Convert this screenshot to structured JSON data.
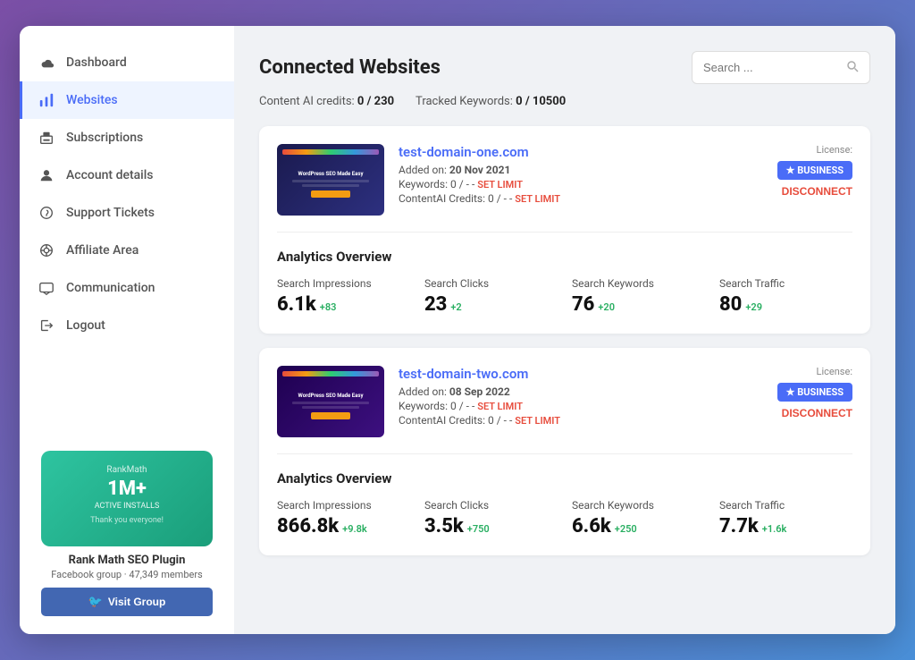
{
  "sidebar": {
    "items": [
      {
        "id": "dashboard",
        "label": "Dashboard",
        "icon": "cloud-icon",
        "active": false
      },
      {
        "id": "websites",
        "label": "Websites",
        "icon": "chart-icon",
        "active": true
      },
      {
        "id": "subscriptions",
        "label": "Subscriptions",
        "icon": "printer-icon",
        "active": false
      },
      {
        "id": "account-details",
        "label": "Account details",
        "icon": "user-icon",
        "active": false
      },
      {
        "id": "support-tickets",
        "label": "Support Tickets",
        "icon": "support-icon",
        "active": false
      },
      {
        "id": "affiliate-area",
        "label": "Affiliate Area",
        "icon": "affiliate-icon",
        "active": false
      },
      {
        "id": "communication",
        "label": "Communication",
        "icon": "message-icon",
        "active": false
      },
      {
        "id": "logout",
        "label": "Logout",
        "icon": "logout-icon",
        "active": false
      }
    ]
  },
  "promo": {
    "logo": "RankMath",
    "big_number": "1M+",
    "active_label": "ACTIVE INSTALLS",
    "thanks": "Thank you everyone!",
    "plugin_name": "Rank Math SEO Plugin",
    "group_desc": "Facebook group · 47,349 members",
    "visit_btn": "Visit Group"
  },
  "page": {
    "title": "Connected Websites",
    "search_placeholder": "Search ...",
    "credits_label": "Content AI credits:",
    "credits_value": "0 / 230",
    "keywords_label": "Tracked Keywords:",
    "keywords_value": "0 / 10500"
  },
  "websites": [
    {
      "id": "site-1",
      "name": "test-domain-one.com",
      "added_label": "Added on:",
      "added_date": "20 Nov 2021",
      "keywords_label": "Keywords:",
      "keywords_value": "0 / -",
      "contentai_label": "ContentAI Credits:",
      "contentai_value": "0 / -",
      "set_limit": "SET LIMIT",
      "license_label": "License:",
      "license_badge": "★ BUSINESS",
      "disconnect_label": "DISCONNECT",
      "analytics": {
        "title": "Analytics Overview",
        "items": [
          {
            "label": "Search Impressions",
            "value": "6.1k",
            "delta": "+83"
          },
          {
            "label": "Search Clicks",
            "value": "23",
            "delta": "+2"
          },
          {
            "label": "Search Keywords",
            "value": "76",
            "delta": "+20"
          },
          {
            "label": "Search Traffic",
            "value": "80",
            "delta": "+29"
          }
        ]
      }
    },
    {
      "id": "site-2",
      "name": "test-domain-two.com",
      "added_label": "Added on:",
      "added_date": "08 Sep 2022",
      "keywords_label": "Keywords:",
      "keywords_value": "0 / -",
      "contentai_label": "ContentAI Credits:",
      "contentai_value": "0 / -",
      "set_limit": "SET LIMIT",
      "license_label": "License:",
      "license_badge": "★ BUSINESS",
      "disconnect_label": "DISCONNECT",
      "analytics": {
        "title": "Analytics Overview",
        "items": [
          {
            "label": "Search Impressions",
            "value": "866.8k",
            "delta": "+9.8k"
          },
          {
            "label": "Search Clicks",
            "value": "3.5k",
            "delta": "+750"
          },
          {
            "label": "Search Keywords",
            "value": "6.6k",
            "delta": "+250"
          },
          {
            "label": "Search Traffic",
            "value": "7.7k",
            "delta": "+1.6k"
          }
        ]
      }
    }
  ]
}
